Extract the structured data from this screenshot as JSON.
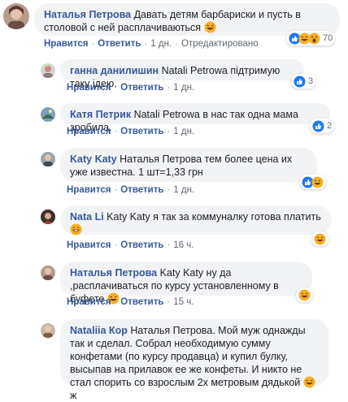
{
  "comments": [
    {
      "author": "Наталья Петрова",
      "text": "Давать детям барбариски и пусть в столовой с ней расплачиваються",
      "actions": {
        "like": "Нравится",
        "reply": "Ответить",
        "time": "1 дн.",
        "edited": "Отредактировано"
      },
      "reactions": {
        "icons": [
          "like-icon",
          "laugh-icon",
          "wow-icon"
        ],
        "count": "70"
      }
    },
    {
      "author": "ганна данилишин",
      "text": "Natali Petrowa підтримую таку ідею.",
      "actions": {
        "like": "Нравится",
        "reply": "Ответить",
        "time": "1 дн."
      },
      "reactions": {
        "icons": [
          "like-icon"
        ],
        "count": "3"
      }
    },
    {
      "author": "Катя Петрик",
      "text": "Natali Petrowa в нас так одна мама зробила.",
      "actions": {
        "like": "Нравится",
        "reply": "Ответить",
        "time": "1 дн."
      },
      "reactions": {
        "icons": [
          "like-icon"
        ],
        "count": "2"
      }
    },
    {
      "author": "Katy Katy",
      "text": "Наталья Петрова тем более цена их уже известна. 1 шт=1,33 грн",
      "actions": {
        "like": "Нравится",
        "reply": "Ответить",
        "time": "1 дн."
      },
      "reactions": {
        "icons": [
          "like-icon",
          "laugh-icon"
        ],
        "count": ""
      }
    },
    {
      "author": "Nata Li",
      "text": "Katy Katy я так за коммуналку готова платить",
      "actions": {
        "like": "Нравится",
        "reply": "Ответить",
        "time": "16 ч."
      },
      "reactions": {
        "icons": [
          "laugh-icon"
        ],
        "count": ""
      }
    },
    {
      "author": "Наталья Петрова",
      "text": "Katy Katy ну да ,расплачиваться по курсу установленному в буфете",
      "actions": {
        "like": "Нравится",
        "reply": "Ответить",
        "time": "15 ч."
      },
      "reactions": {
        "icons": [
          "laugh-icon"
        ],
        "count": ""
      }
    },
    {
      "author": "Nataliia Кор",
      "text": "Наталья Петрова. Мой муж однажды так и сделал. Собрал необходимую сумму конфетами (по курсу продавца) и купил булку, высыпав на прилавок ее же конфеты. И никто не стал спорить со взрослым 2х метровым дядькой",
      "tail": "ж",
      "actions": {},
      "reactions": {
        "icons": [],
        "count": ""
      }
    }
  ],
  "colors": {
    "link": "#385898",
    "bubble": "#f2f3f5",
    "like": "#2078f4",
    "laugh": "#f7b125"
  }
}
